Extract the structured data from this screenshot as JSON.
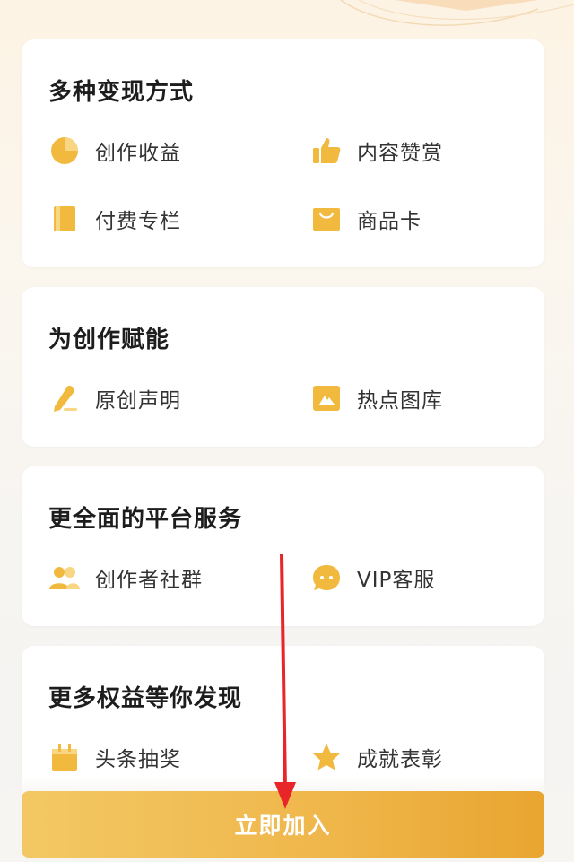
{
  "sections": [
    {
      "title": "多种变现方式",
      "items": [
        {
          "label": "创作收益",
          "icon": "pie-chart-icon"
        },
        {
          "label": "内容赞赏",
          "icon": "thumbs-up-icon"
        },
        {
          "label": "付费专栏",
          "icon": "book-icon"
        },
        {
          "label": "商品卡",
          "icon": "shopping-bag-icon"
        }
      ]
    },
    {
      "title": "为创作赋能",
      "items": [
        {
          "label": "原创声明",
          "icon": "pencil-icon"
        },
        {
          "label": "热点图库",
          "icon": "image-icon"
        }
      ]
    },
    {
      "title": "更全面的平台服务",
      "items": [
        {
          "label": "创作者社群",
          "icon": "people-icon"
        },
        {
          "label": "VIP客服",
          "icon": "chat-bubble-icon"
        }
      ]
    },
    {
      "title": "更多权益等你发现",
      "items": [
        {
          "label": "头条抽奖",
          "icon": "gift-box-icon"
        },
        {
          "label": "成就表彰",
          "icon": "star-icon"
        }
      ]
    }
  ],
  "join_button": {
    "label": "立即加入"
  },
  "colors": {
    "accent": "#f0b43c",
    "icon": "#f2b93f",
    "arrow": "#e8262a"
  }
}
